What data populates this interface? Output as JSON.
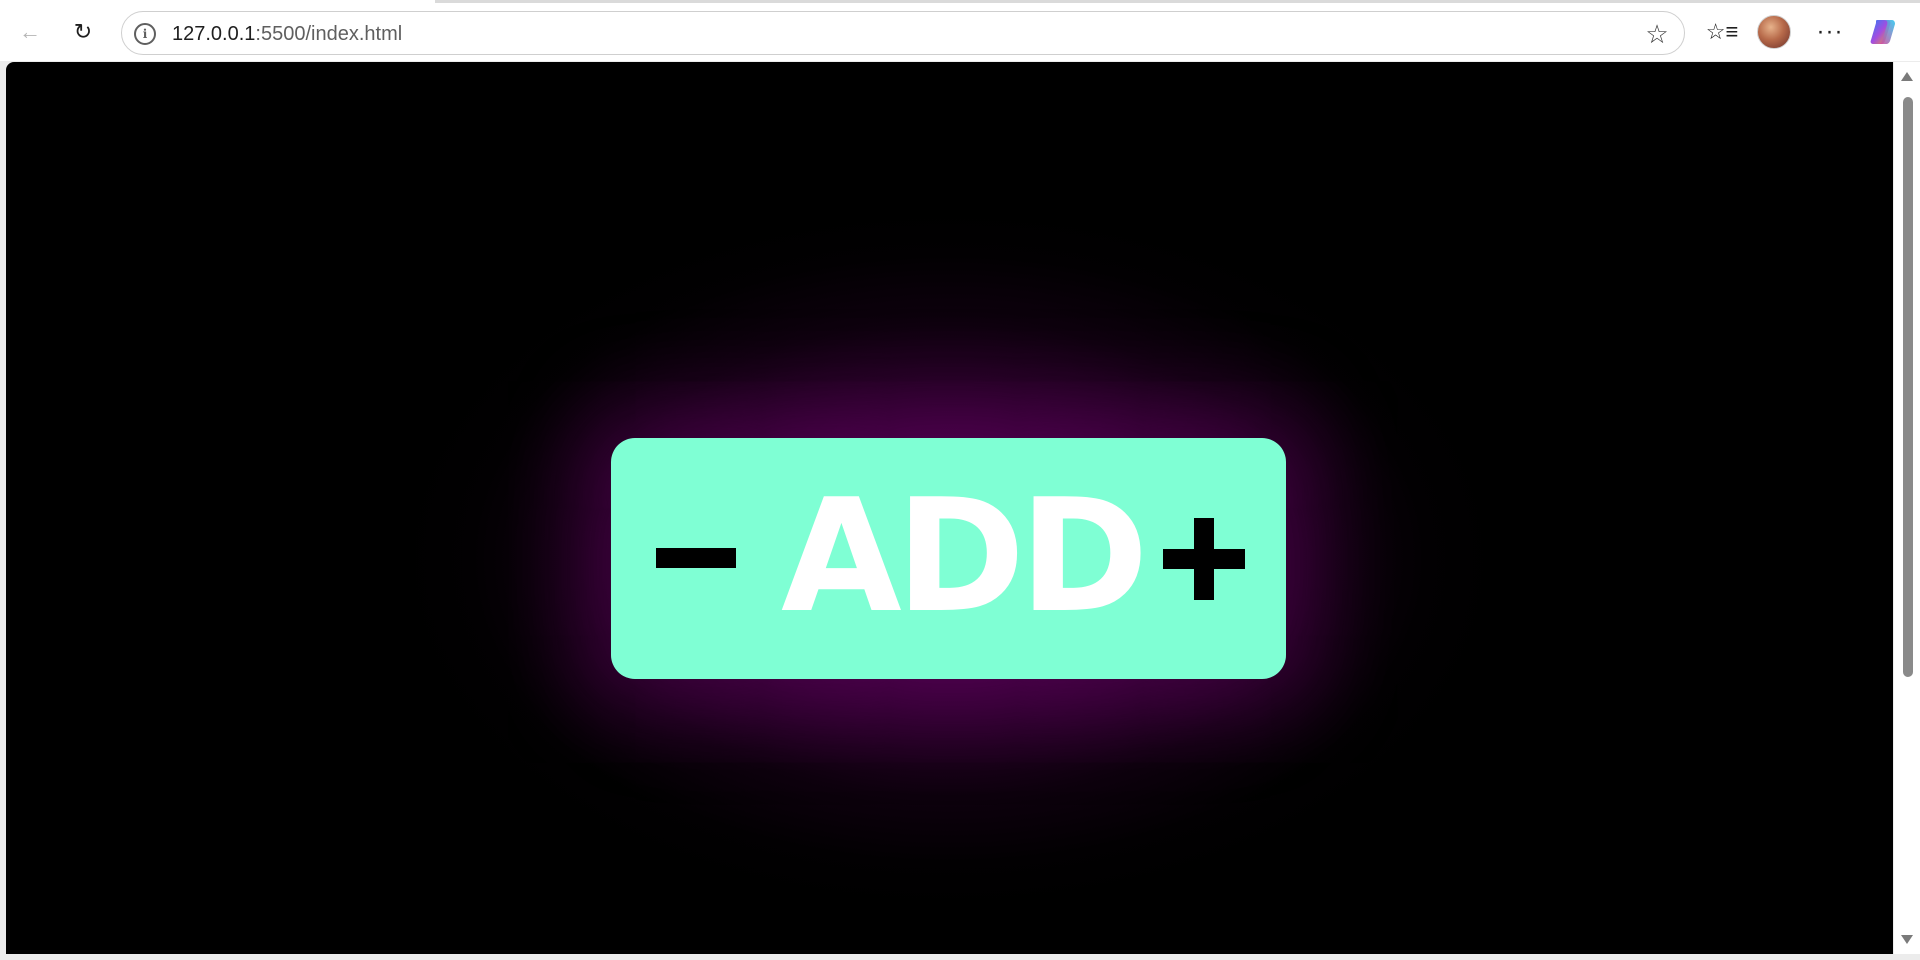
{
  "browser": {
    "url_host": "127.0.0.1",
    "url_path": ":5500/index.html",
    "icons": {
      "back": "arrow-left-icon",
      "reload": "reload-icon",
      "site_info": "info-icon",
      "favorite": "star-icon",
      "favorites_list": "favorites-list-icon",
      "profile": "avatar",
      "menu": "ellipsis-icon",
      "copilot": "copilot-icon"
    },
    "info_glyph": "i",
    "star_glyph": "☆",
    "back_glyph": "←",
    "reload_glyph": "↻",
    "favorites_glyph": "☆≡",
    "menu_glyph": "···"
  },
  "page": {
    "background_color": "#000000",
    "glow_color": "#a000a0",
    "widget": {
      "background_color": "#7fffd4",
      "label": "ADD",
      "label_color": "#ffffff",
      "minus_icon": "minus-icon",
      "plus_icon": "plus-icon"
    }
  }
}
